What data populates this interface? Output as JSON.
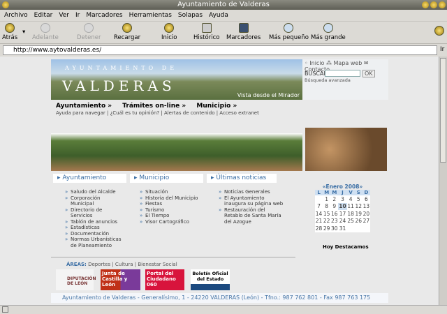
{
  "window": {
    "title": "Ayuntamiento de Valderas"
  },
  "menu": [
    "Archivo",
    "Editar",
    "Ver",
    "Ir",
    "Marcadores",
    "Herramientas",
    "Solapas",
    "Ayuda"
  ],
  "toolbar": {
    "back": "Atrás",
    "forward": "Adelante",
    "stop": "Detener",
    "reload": "Recargar",
    "home": "Inicio",
    "history": "Histórico",
    "bookmarks": "Marcadores",
    "smaller": "Más pequeño",
    "bigger": "Más grande"
  },
  "urlbar": {
    "url": "http://www.aytovalderas.es/",
    "go": "Ir"
  },
  "page": {
    "header": {
      "line1": "AYUNTAMIENTO DE",
      "line2": "VALDERAS",
      "caption": "Vista desde el Mirador"
    },
    "top_links": "◦ Inicio ⁂ Mapa web ✉ Contacto",
    "search": {
      "label": "BUSCAR",
      "button": "OK",
      "advanced": "Búsqueda avanzada"
    },
    "nav": [
      "Ayuntamiento »",
      "Trámites on-line »",
      "Municipio »"
    ],
    "subnav": "Ayuda para navegar | ¿Cuál es tu opinión? | Alertas de contenido | Acceso extranet",
    "sections": [
      {
        "title": "Ayuntamiento",
        "items": [
          "Saludo del Alcalde",
          "Corporación Municipal",
          "Directorio de Servicios",
          "Tablón de anuncios",
          "Estadísticas",
          "Documentación",
          "Normas Urbanísticas de Planeamiento"
        ]
      },
      {
        "title": "Municipio",
        "items": [
          "Situación",
          "Historia del Municipio",
          "Fiestas",
          "Turismo",
          "El Tiempo",
          "Visor Cartográfico"
        ]
      },
      {
        "title": "Últimas noticias",
        "items": [
          "Noticias Generales",
          "El Ayuntamiento inaugura su página web",
          "Restauración del Retablo de Santa María del Azogue"
        ]
      }
    ],
    "calendar": {
      "month": "«Enero 2008»",
      "days": [
        "L",
        "M",
        "M",
        "J",
        "V",
        "S",
        "D"
      ],
      "today": "10",
      "weeks": [
        [
          "",
          "1",
          "2",
          "3",
          "4",
          "5",
          "6"
        ],
        [
          "7",
          "8",
          "9",
          "10",
          "11",
          "12",
          "13"
        ],
        [
          "14",
          "15",
          "16",
          "17",
          "18",
          "19",
          "20"
        ],
        [
          "21",
          "22",
          "23",
          "24",
          "25",
          "26",
          "27"
        ],
        [
          "28",
          "29",
          "30",
          "31",
          "",
          "",
          ""
        ]
      ]
    },
    "hoy": "Hoy Destacamos",
    "areas": {
      "label": "ÁREAS:",
      "links": "Deportes | Cultura | Bienestar Social"
    },
    "logos": [
      "DIPUTACIÓN DE LEÓN",
      "Junta de Castilla y León",
      "Portal del Ciudadano 060",
      "Boletín Oficial del Estado"
    ],
    "footer": "Ayuntamiento de Valderas - Generalísimo, 1 - 24220 VALDERAS (León) - Tfno.: 987 762 801 - Fax 987 763 175"
  }
}
